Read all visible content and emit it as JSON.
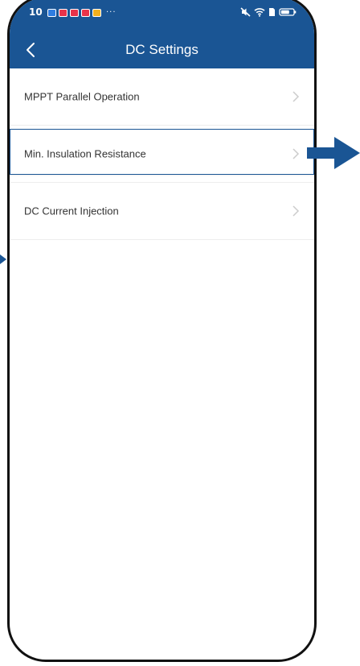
{
  "status_bar": {
    "time": "10",
    "notification_colors": [
      "#2f7de1",
      "#e8334a",
      "#e8334a",
      "#e8334a",
      "#f2b01e"
    ],
    "more": "···"
  },
  "header": {
    "title": "DC Settings",
    "back_icon": "chevron-left-icon"
  },
  "settings_list": [
    {
      "label": "MPPT Parallel Operation"
    },
    {
      "label": "Min. Insulation Resistance"
    },
    {
      "label": "DC Current Injection"
    }
  ],
  "colors": {
    "header_bg": "#1a5594",
    "annotation": "#1a5594"
  }
}
